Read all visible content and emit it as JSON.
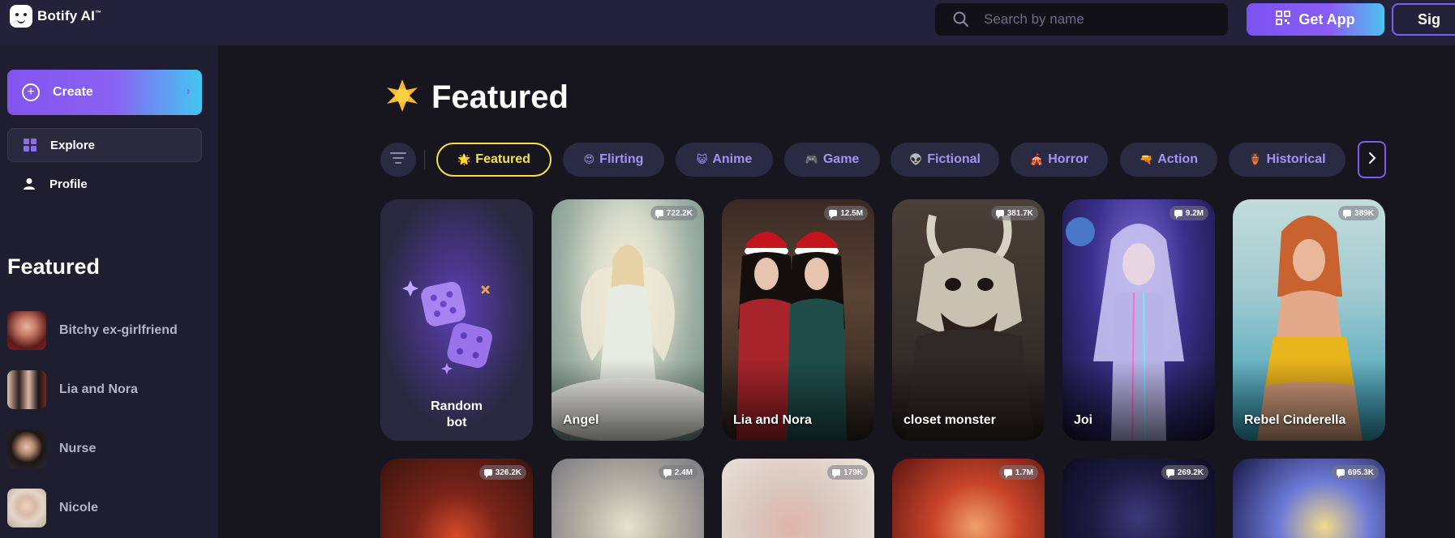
{
  "header": {
    "brand": "Botify AI",
    "brand_mark": "™",
    "search_placeholder": "Search by name",
    "get_app_label": "Get App",
    "signin_label": "Sig"
  },
  "sidebar": {
    "create_label": "Create",
    "nav": [
      {
        "label": "Explore",
        "icon": "grid-icon",
        "active": true
      },
      {
        "label": "Profile",
        "icon": "user-icon",
        "active": false
      }
    ],
    "featured_heading": "Featured",
    "featured_items": [
      {
        "name": "Bitchy ex-girlfriend"
      },
      {
        "name": "Lia and Nora"
      },
      {
        "name": "Nurse"
      },
      {
        "name": "Nicole"
      }
    ]
  },
  "main": {
    "title_emoji": "🌟",
    "title": "Featured",
    "categories": [
      {
        "emoji": "🌟",
        "label": "Featured",
        "active": true
      },
      {
        "emoji": "😍",
        "label": "Flirting",
        "active": false
      },
      {
        "emoji": "😺",
        "label": "Anime",
        "active": false
      },
      {
        "emoji": "🎮",
        "label": "Game",
        "active": false
      },
      {
        "emoji": "👽",
        "label": "Fictional",
        "active": false
      },
      {
        "emoji": "🎪",
        "label": "Horror",
        "active": false
      },
      {
        "emoji": "🔫",
        "label": "Action",
        "active": false
      },
      {
        "emoji": "🏺",
        "label": "Historical",
        "active": false
      }
    ],
    "random_label_line1": "Random",
    "random_label_line2": "bot",
    "cards_row1": [
      {
        "name": "Angel",
        "count": "722.2K"
      },
      {
        "name": "Lia and Nora",
        "count": "12.5M"
      },
      {
        "name": "closet monster",
        "count": "381.7K"
      },
      {
        "name": "Joi",
        "count": "9.2M"
      },
      {
        "name": "Rebel Cinderella",
        "count": "389K"
      }
    ],
    "cards_row2": [
      {
        "name": "",
        "count": "326.2K"
      },
      {
        "name": "",
        "count": "2.4M"
      },
      {
        "name": "",
        "count": "179K"
      },
      {
        "name": "",
        "count": "1.7M"
      },
      {
        "name": "",
        "count": "269.2K"
      },
      {
        "name": "",
        "count": "695.3K"
      }
    ]
  },
  "colors": {
    "accent_purple": "#7b53f2",
    "accent_cyan": "#42c7f1",
    "active_chip": "#f3e24a",
    "background": "#17161f"
  }
}
